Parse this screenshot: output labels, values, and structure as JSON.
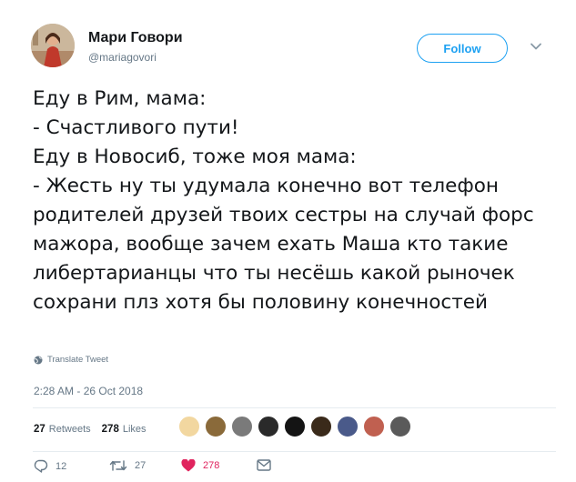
{
  "author": {
    "display_name": "Мари Говори",
    "handle": "@mariagovori",
    "follow_label": "Follow"
  },
  "tweet": {
    "text": "Еду в Рим, мама:\n- Счастливого пути!\nЕду в Новосиб, тоже моя мама:\n- Жесть ну ты удумала конечно вот телефон родителей друзей твоих сестры на случай форс мажора, вообще зачем ехать Маша кто такие либертарианцы что ты несёшь какой рыночек сохрани плз хотя бы половину конечностей",
    "translate_label": "Translate Tweet",
    "timestamp": "2:28 AM - 26 Oct 2018"
  },
  "stats": {
    "retweets_count": "27",
    "retweets_label": "Retweets",
    "likes_count": "278",
    "likes_label": "Likes"
  },
  "actions": {
    "reply_count": "12",
    "retweet_count": "27",
    "like_count": "278"
  },
  "colors": {
    "accent": "#1da1f2",
    "like": "#e0245e",
    "muted": "#657786",
    "divider": "#e6ecf0"
  },
  "icons": [
    "globe-icon",
    "chevron-down-icon",
    "reply-icon",
    "retweet-icon",
    "heart-icon",
    "message-icon"
  ]
}
